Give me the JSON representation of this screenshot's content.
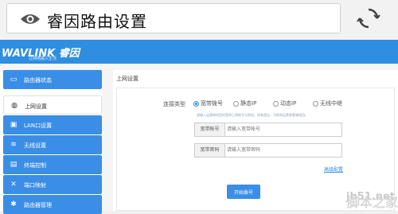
{
  "browser": {
    "title": "睿因路由设置",
    "icons": {
      "view": "eye-icon",
      "reload": "reload-icon"
    }
  },
  "brand": {
    "logo": "WAVLINK 睿因",
    "tagline": "让网络融入生活",
    "color": "#2f8ee0"
  },
  "sidebar": {
    "items": [
      {
        "label": "路由器状态",
        "icon": "monitor-icon",
        "glyph": "▭",
        "active": false
      },
      {
        "label": "上网设置",
        "icon": "globe-icon",
        "glyph": "◍",
        "active": true
      },
      {
        "label": "LAN口设置",
        "icon": "lan-icon",
        "glyph": "▣",
        "active": false
      },
      {
        "label": "无线设置",
        "icon": "wifi-icon",
        "glyph": "≋",
        "active": false
      },
      {
        "label": "终端控制",
        "icon": "terminal-icon",
        "glyph": "▤",
        "active": false
      },
      {
        "label": "端口映射",
        "icon": "tools-icon",
        "glyph": "✕",
        "active": false
      },
      {
        "label": "路由器管理",
        "icon": "gear-icon",
        "glyph": "✱",
        "active": false
      }
    ]
  },
  "main": {
    "title": "上网设置",
    "connection_type_label": "连接类型",
    "options": [
      "宽带拨号",
      "静态IP",
      "动态IP",
      "无线中继"
    ],
    "selected_option": "宽带拨号",
    "hint": "请输入运营商给您的宽带上网帐号与密码。如有遗忘，可致电运营商客服找回。",
    "account": {
      "label": "宽带帐号",
      "placeholder": "请输入宽带帐号"
    },
    "password": {
      "label": "宽带密码",
      "placeholder": "请输入宽带密码"
    },
    "advanced_link": "高级配置",
    "dial_button": "开始拨号"
  },
  "watermark": {
    "line1": "jb51.net",
    "line2": "脚本之家"
  }
}
